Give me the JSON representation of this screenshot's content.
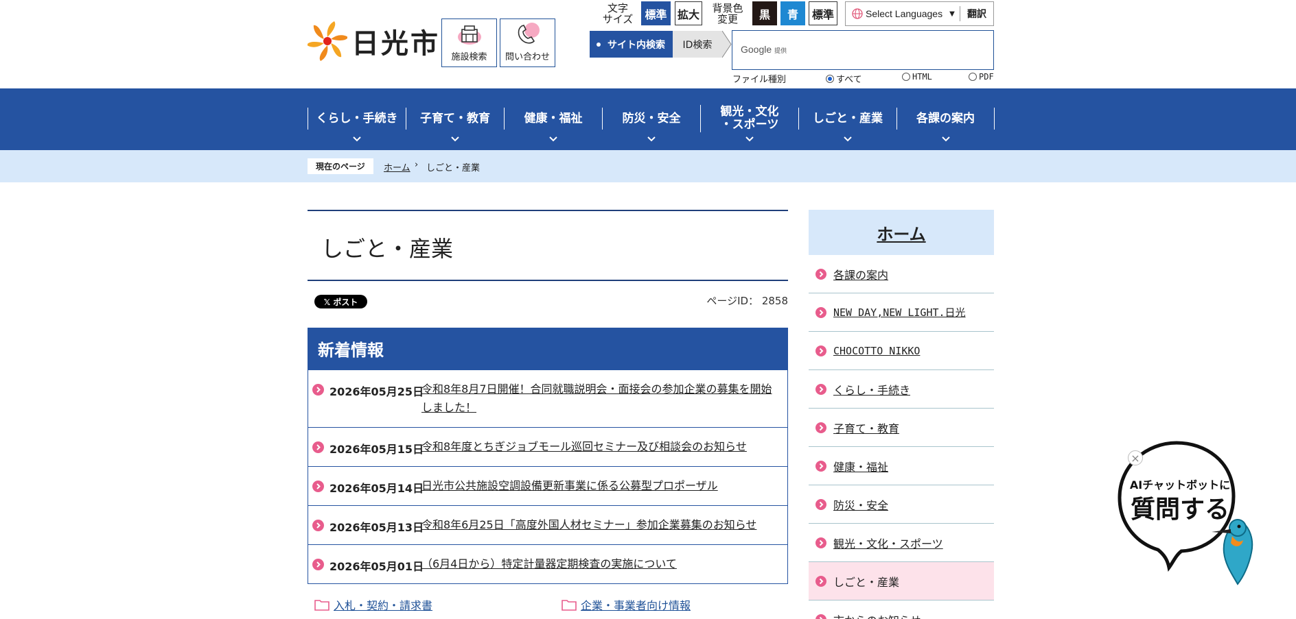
{
  "header": {
    "site_name": "日光市",
    "facility_search_label": "施設検索",
    "contact_label": "問い合わせ",
    "text_size_label_line1": "文字",
    "text_size_label_line2": "サイズ",
    "text_size_standard": "標準",
    "text_size_large": "拡大",
    "bg_color_label_line1": "背景色",
    "bg_color_label_line2": "変更",
    "bg_black": "黒",
    "bg_blue": "青",
    "bg_standard": "標準",
    "language_select": "Select Languages",
    "translate_button": "翻訳",
    "search_tab_site": "サイト内検索",
    "search_tab_id": "ID検索",
    "google_label": "Google",
    "google_provided": "提供",
    "file_type_label": "ファイル種別",
    "file_type_all": "すべて",
    "file_type_html": "HTML",
    "file_type_pdf": "PDF"
  },
  "nav": {
    "items": [
      {
        "label": "くらし・手続き"
      },
      {
        "label": "子育て・教育"
      },
      {
        "label": "健康・福祉"
      },
      {
        "label": "防災・安全"
      },
      {
        "label": "観光・文化",
        "label2": "・スポーツ"
      },
      {
        "label": "しごと・産業"
      },
      {
        "label": "各課の案内"
      }
    ]
  },
  "breadcrumb": {
    "current_page_tag": "現在のページ",
    "home": "ホーム",
    "separator": "›",
    "current": "しごと・産業"
  },
  "main": {
    "title": "しごと・産業",
    "x_post": "𝕏 ポスト",
    "page_id": "ページID： 2858",
    "news_title": "新着情報",
    "news": [
      {
        "date": "2026年05月25日",
        "title": "令和8年8月7日開催！合同就職説明会・面接会の参加企業の募集を開始しました！"
      },
      {
        "date": "2026年05月15日",
        "title": "令和8年度とちぎジョブモール巡回セミナー及び相談会のお知らせ"
      },
      {
        "date": "2026年05月14日",
        "title": "日光市公共施設空調設備更新事業に係る公募型プロポーザル"
      },
      {
        "date": "2026年05月13日",
        "title": "令和8年6月25日「高度外国人材セミナー」参加企業募集のお知らせ"
      },
      {
        "date": "2026年05月01日",
        "title": "（6月4日から）特定計量器定期検査の実施について"
      }
    ],
    "folder_links": [
      "入札・契約・請求書",
      "企業・事業者向け情報"
    ]
  },
  "side": {
    "home": "ホーム",
    "items": [
      {
        "label": "各課の案内"
      },
      {
        "label": "NEW DAY,NEW LIGHT.日光"
      },
      {
        "label": "CHOCOTTO NIKKO"
      },
      {
        "label": "くらし・手続き"
      },
      {
        "label": "子育て・教育"
      },
      {
        "label": "健康・福祉"
      },
      {
        "label": "防災・安全"
      },
      {
        "label": "観光・文化・スポーツ"
      },
      {
        "label": "しごと・産業"
      },
      {
        "label": "市からのお知らせ"
      }
    ]
  },
  "chatbot": {
    "line1": "AIチャットボットに",
    "line2": "質問する",
    "close": "×"
  },
  "colors": {
    "primary_blue": "#2553a1",
    "light_blue": "#d7e8fa",
    "accent_pink": "#e85c8c",
    "active_pink": "#fde2ea"
  }
}
